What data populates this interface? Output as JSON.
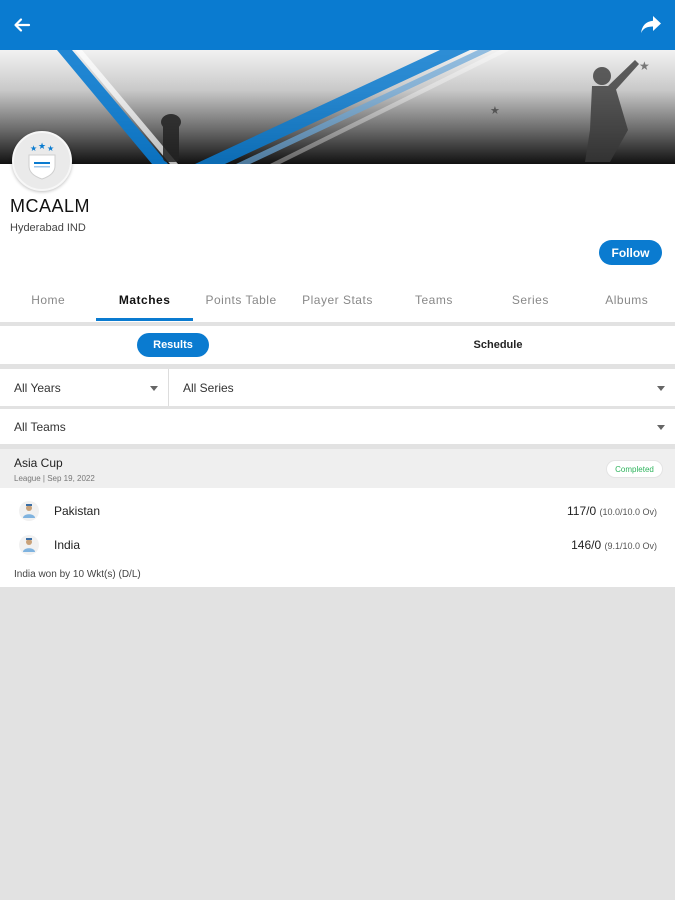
{
  "header": {
    "back_icon": "arrow-left-icon",
    "share_icon": "share-icon",
    "accent": "#0a7bd0"
  },
  "profile": {
    "name": "MCAALM",
    "location": "Hyderabad IND",
    "follow_label": "Follow"
  },
  "tabs": [
    {
      "label": "Home",
      "active": false
    },
    {
      "label": "Matches",
      "active": true
    },
    {
      "label": "Points Table",
      "active": false
    },
    {
      "label": "Player Stats",
      "active": false
    },
    {
      "label": "Teams",
      "active": false
    },
    {
      "label": "Series",
      "active": false
    },
    {
      "label": "Albums",
      "active": false
    }
  ],
  "segment": {
    "results_label": "Results",
    "schedule_label": "Schedule",
    "selected": "Results"
  },
  "filters": {
    "years": "All Years",
    "series": "All Series",
    "teams": "All Teams"
  },
  "match": {
    "series": "Asia Cup",
    "meta": "League | Sep 19, 2022",
    "status": "Completed",
    "status_color": "#2eb35c",
    "teams": [
      {
        "name": "Pakistan",
        "score": "117/0",
        "overs": "(10.0/10.0 Ov)"
      },
      {
        "name": "India",
        "score": "146/0",
        "overs": "(9.1/10.0 Ov)"
      }
    ],
    "result": "India won by 10 Wkt(s) (D/L)"
  }
}
